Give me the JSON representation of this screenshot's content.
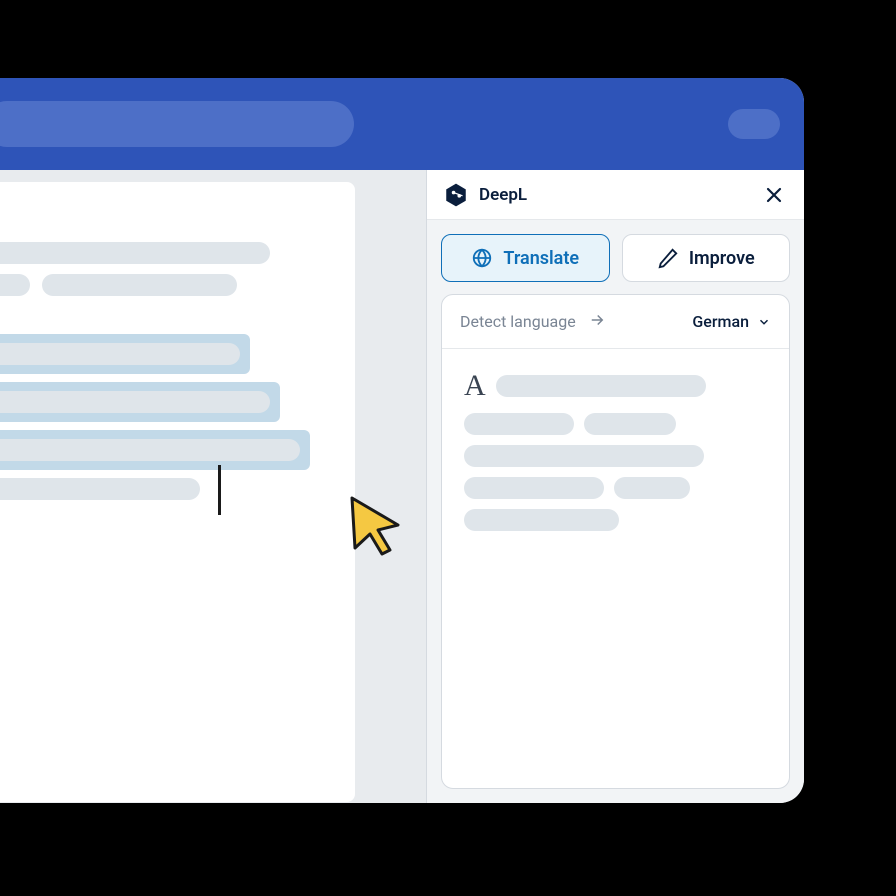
{
  "sidebar": {
    "brand": "DeepL",
    "tabs": {
      "translate": "Translate",
      "improve": "Improve"
    },
    "language": {
      "source": "Detect language",
      "target": "German"
    },
    "output_marker": "A"
  }
}
